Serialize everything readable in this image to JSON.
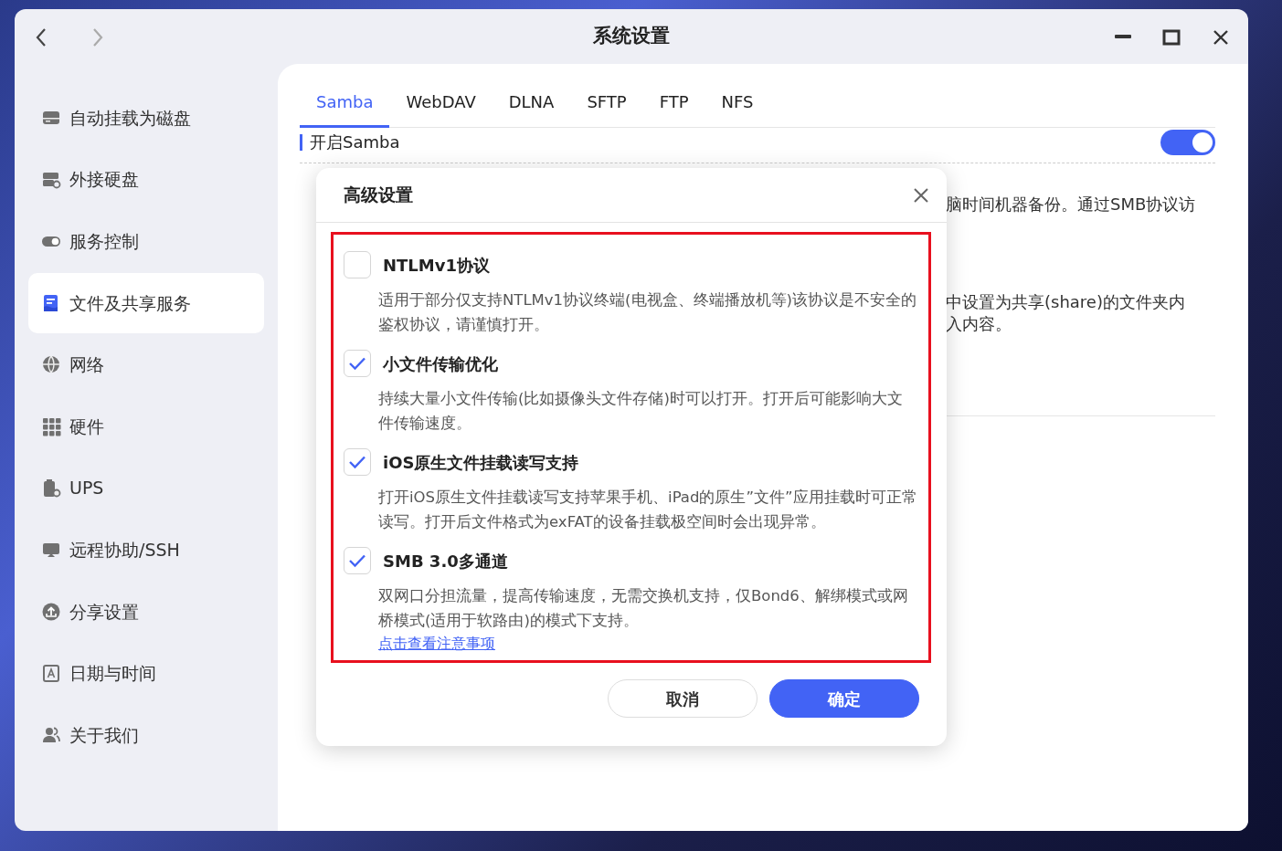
{
  "window": {
    "title": "系统设置"
  },
  "sidebar": {
    "items": [
      {
        "label": "自动挂载为磁盘",
        "selected": false
      },
      {
        "label": "外接硬盘",
        "selected": false
      },
      {
        "label": "服务控制",
        "selected": false
      },
      {
        "label": "文件及共享服务",
        "selected": true
      },
      {
        "label": "网络",
        "selected": false
      },
      {
        "label": "硬件",
        "selected": false
      },
      {
        "label": "UPS",
        "selected": false
      },
      {
        "label": "远程协助/SSH",
        "selected": false
      },
      {
        "label": "分享设置",
        "selected": false
      },
      {
        "label": "日期与时间",
        "selected": false
      },
      {
        "label": "关于我们",
        "selected": false
      }
    ]
  },
  "tabs": [
    {
      "label": "Samba",
      "selected": true
    },
    {
      "label": "WebDAV",
      "selected": false
    },
    {
      "label": "DLNA",
      "selected": false
    },
    {
      "label": "SFTP",
      "selected": false
    },
    {
      "label": "FTP",
      "selected": false
    },
    {
      "label": "NFS",
      "selected": false
    }
  ],
  "section": {
    "title": "开启Samba",
    "on": true,
    "texts": [
      "脑时间机器备份。通过SMB协议访",
      "中设置为共享(share)的文件夹内",
      "入内容。"
    ]
  },
  "dialog": {
    "title": "高级设置",
    "options": [
      {
        "label": "NTLMv1协议",
        "checked": false,
        "description": "适用于部分仅支持NTLMv1协议终端(电视盒、终端播放机等)该协议是不安全的鉴权协议，请谨慎打开。"
      },
      {
        "label": "小文件传输优化",
        "checked": true,
        "description": "持续大量小文件传输(比如摄像头文件存储)时可以打开。打开后可能影响大文件传输速度。"
      },
      {
        "label": "iOS原生文件挂载读写支持",
        "checked": true,
        "description": "打开iOS原生文件挂载读写支持苹果手机、iPad的原生”文件”应用挂载时可正常读写。打开后文件格式为exFAT的设备挂载极空间时会出现异常。"
      },
      {
        "label": "SMB 3.0多通道",
        "checked": true,
        "description": "双网口分担流量，提高传输速度，无需交换机支持，仅Bond6、解绑模式或网桥模式(适用于软路由)的模式下支持。",
        "link": "点击查看注意事项"
      }
    ],
    "buttons": [
      {
        "label": "取消",
        "kind": "secondary"
      },
      {
        "label": "确定",
        "kind": "primary"
      }
    ]
  }
}
